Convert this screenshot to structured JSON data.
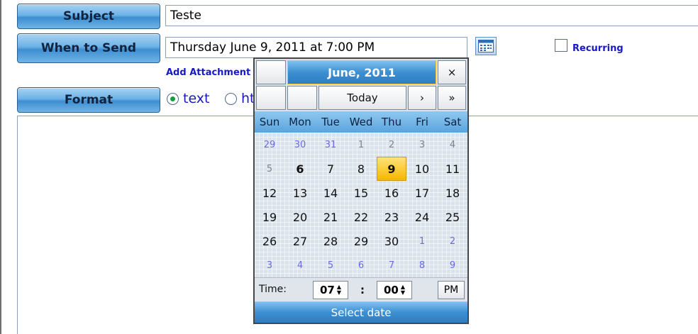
{
  "form": {
    "subject_label": "Subject",
    "subject_value": "Teste",
    "when_label": "When to Send",
    "when_value": "Thursday June 9, 2011 at 7:00 PM",
    "recurring_label": "Recurring",
    "attachment_link": "Add Attachment",
    "format_label": "Format",
    "format_text": "text",
    "format_html_partial": "ht"
  },
  "icons": {
    "calendar": "calendar-icon",
    "close": "×",
    "next": "›",
    "next_year": "»",
    "spin_up": "▲",
    "spin_down": "▼"
  },
  "calendar": {
    "title": "June, 2011",
    "today_label": "Today",
    "weekdays": [
      "Sun",
      "Mon",
      "Tue",
      "Wed",
      "Thu",
      "Fri",
      "Sat"
    ],
    "weeks": [
      [
        "29",
        "30",
        "31",
        "1",
        "2",
        "3",
        "4"
      ],
      [
        "5",
        "6",
        "7",
        "8",
        "9",
        "10",
        "11"
      ],
      [
        "12",
        "13",
        "14",
        "15",
        "16",
        "17",
        "18"
      ],
      [
        "19",
        "20",
        "21",
        "22",
        "23",
        "24",
        "25"
      ],
      [
        "26",
        "27",
        "28",
        "29",
        "30",
        "1",
        "2"
      ],
      [
        "3",
        "4",
        "5",
        "6",
        "7",
        "8",
        "9"
      ]
    ],
    "time_label": "Time:",
    "hour": "07",
    "colon": ":",
    "minute": "00",
    "ampm": "PM",
    "footer": "Select date"
  },
  "colors": {
    "accent_blue": "#3e8ed1",
    "selected_day": "#f5b800",
    "link_blue": "#1818c8",
    "radio_green": "#1d9c3e"
  }
}
